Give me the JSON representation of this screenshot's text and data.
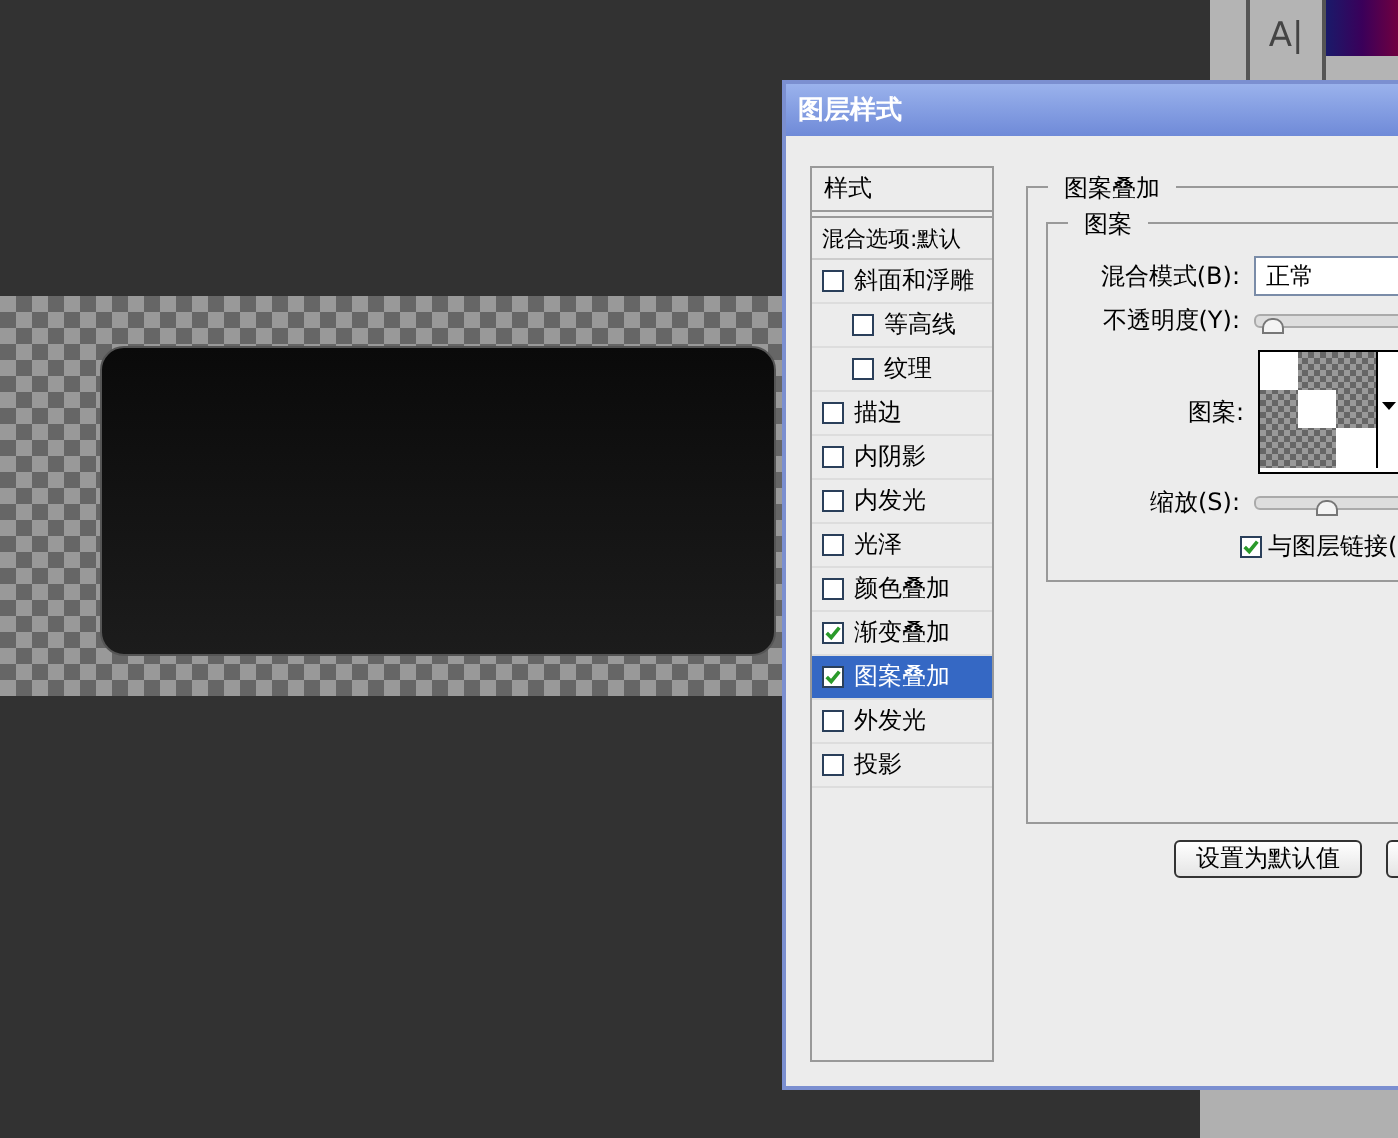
{
  "toolbox": {
    "tool_label": "A|"
  },
  "dialog": {
    "title": "图层样式",
    "sidebar": {
      "header": "样式",
      "blend_options": "混合选项:默认",
      "items": [
        {
          "label": "斜面和浮雕",
          "checked": false,
          "selected": false,
          "children": [
            {
              "label": "等高线",
              "checked": false,
              "selected": false
            },
            {
              "label": "纹理",
              "checked": false,
              "selected": false
            }
          ]
        },
        {
          "label": "描边",
          "checked": false,
          "selected": false
        },
        {
          "label": "内阴影",
          "checked": false,
          "selected": false
        },
        {
          "label": "内发光",
          "checked": false,
          "selected": false
        },
        {
          "label": "光泽",
          "checked": false,
          "selected": false
        },
        {
          "label": "颜色叠加",
          "checked": false,
          "selected": false
        },
        {
          "label": "渐变叠加",
          "checked": true,
          "selected": false
        },
        {
          "label": "图案叠加",
          "checked": true,
          "selected": true
        },
        {
          "label": "外发光",
          "checked": false,
          "selected": false
        },
        {
          "label": "投影",
          "checked": false,
          "selected": false
        }
      ]
    },
    "panel": {
      "title": "图案叠加",
      "group": "图案",
      "blend_mode": {
        "label": "混合模式(B):",
        "value": "正常"
      },
      "opacity": {
        "label": "不透明度(Y):",
        "level": 0.05
      },
      "pattern": {
        "label": "图案:"
      },
      "scale": {
        "label": "缩放(S):",
        "level": 0.32
      },
      "link": {
        "label": "与图层链接(",
        "checked": true
      },
      "buttons": [
        "设置为默认值"
      ]
    }
  }
}
